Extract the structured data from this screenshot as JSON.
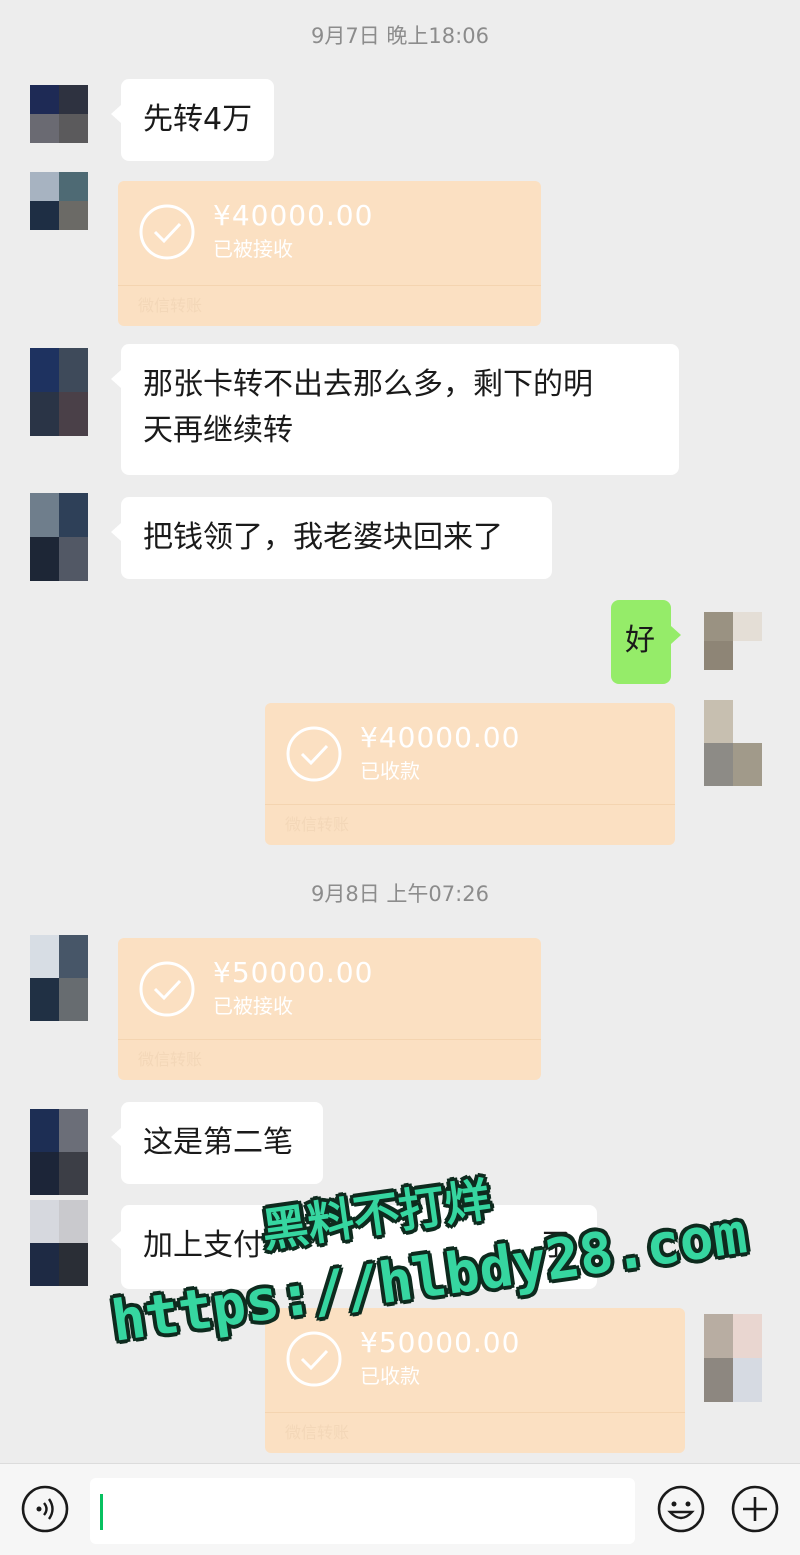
{
  "timestamps": [
    "9月7日 晚上18:06",
    "9月8日 上午07:26"
  ],
  "messages": {
    "m1": "先转4万",
    "m2_line1": "那张卡转不出去那么多，剩下的明",
    "m2_line2": "天再继续转",
    "m3": "把钱领了，我老婆块回来了",
    "m4": "好",
    "m5": "这是第二笔",
    "m6_a": "加上支付",
    "m6_b": "了"
  },
  "transfers": [
    {
      "amount": "¥40000.00",
      "status": "已被接收",
      "footer": "微信转账"
    },
    {
      "amount": "¥40000.00",
      "status": "已收款",
      "footer": "微信转账"
    },
    {
      "amount": "¥50000.00",
      "status": "已被接收",
      "footer": "微信转账"
    },
    {
      "amount": "¥50000.00",
      "status": "已收款",
      "footer": "微信转账"
    }
  ],
  "watermark": {
    "line1": "黑料不打烊",
    "line2": "https://hlbdy28.com"
  },
  "colors": {
    "background": "#ededed",
    "bubble_in": "#ffffff",
    "bubble_out": "#95ec69",
    "transfer": "#fbe0c2",
    "watermark": "#36d6a0"
  },
  "icons": [
    "voice-icon",
    "emoji-icon",
    "plus-icon"
  ]
}
